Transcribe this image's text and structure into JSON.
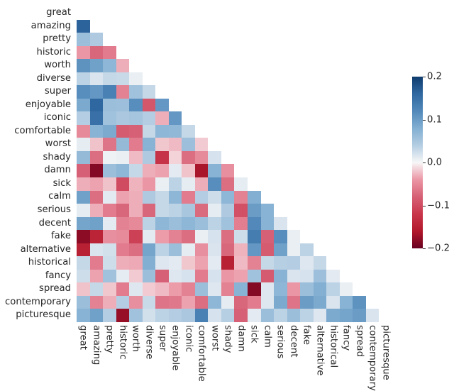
{
  "chart_data": {
    "type": "heatmap",
    "title": "",
    "xlabel": "",
    "ylabel": "",
    "grid": false,
    "triangular": "lower",
    "diagonal_shown": false,
    "colormap": "RdBu (red-white-blue, diverging)",
    "colorbar": {
      "position": "right",
      "vmin": -0.2,
      "vmax": 0.2,
      "ticks": [
        0.2,
        0.1,
        0.0,
        -0.1,
        -0.2
      ],
      "tick_labels": [
        "0.2",
        "0.1",
        "0.0",
        "−0.1",
        "−0.2"
      ],
      "low_color": "#c9364b",
      "mid_color": "#f7f7f7",
      "high_color": "#2f6fa8"
    },
    "categories": [
      "great",
      "amazing",
      "pretty",
      "historic",
      "worth",
      "diverse",
      "super",
      "enjoyable",
      "iconic",
      "comfortable",
      "worst",
      "shady",
      "damn",
      "sick",
      "calm",
      "serious",
      "decent",
      "fake",
      "alternative",
      "historical",
      "fancy",
      "spread",
      "contemporary",
      "picturesque"
    ],
    "xtick_labels": [
      "great",
      "amazing",
      "pretty",
      "historic",
      "worth",
      "diverse",
      "super",
      "enjoyable",
      "iconic",
      "comfortable",
      "worst",
      "shady",
      "damn",
      "sick",
      "calm",
      "serious",
      "decent",
      "fake",
      "alternative",
      "historical",
      "fancy",
      "spread",
      "contemporary",
      "picturesque"
    ],
    "ytick_labels": [
      "great",
      "amazing",
      "pretty",
      "historic",
      "worth",
      "diverse",
      "super",
      "enjoyable",
      "iconic",
      "comfortable",
      "worst",
      "shady",
      "damn",
      "sick",
      "calm",
      "serious",
      "decent",
      "fake",
      "alternative",
      "historical",
      "fancy",
      "spread",
      "contemporary",
      "picturesque"
    ],
    "values": [
      [
        null,
        null,
        null,
        null,
        null,
        null,
        null,
        null,
        null,
        null,
        null,
        null,
        null,
        null,
        null,
        null,
        null,
        null,
        null,
        null,
        null,
        null,
        null,
        null
      ],
      [
        0.165,
        null,
        null,
        null,
        null,
        null,
        null,
        null,
        null,
        null,
        null,
        null,
        null,
        null,
        null,
        null,
        null,
        null,
        null,
        null,
        null,
        null,
        null,
        null
      ],
      [
        0.06,
        0.045,
        null,
        null,
        null,
        null,
        null,
        null,
        null,
        null,
        null,
        null,
        null,
        null,
        null,
        null,
        null,
        null,
        null,
        null,
        null,
        null,
        null,
        null
      ],
      [
        -0.04,
        -0.075,
        -0.06,
        null,
        null,
        null,
        null,
        null,
        null,
        null,
        null,
        null,
        null,
        null,
        null,
        null,
        null,
        null,
        null,
        null,
        null,
        null,
        null,
        null
      ],
      [
        0.11,
        0.095,
        0.07,
        -0.03,
        null,
        null,
        null,
        null,
        null,
        null,
        null,
        null,
        null,
        null,
        null,
        null,
        null,
        null,
        null,
        null,
        null,
        null,
        null,
        null
      ],
      [
        0.035,
        0.018,
        0.03,
        0.028,
        0.008,
        null,
        null,
        null,
        null,
        null,
        null,
        null,
        null,
        null,
        null,
        null,
        null,
        null,
        null,
        null,
        null,
        null,
        null,
        null
      ],
      [
        0.115,
        0.105,
        0.13,
        -0.055,
        0.055,
        0.03,
        null,
        null,
        null,
        null,
        null,
        null,
        null,
        null,
        null,
        null,
        null,
        null,
        null,
        null,
        null,
        null,
        null,
        null
      ],
      [
        0.085,
        0.16,
        0.06,
        0.058,
        0.115,
        -0.09,
        0.105,
        null,
        null,
        null,
        null,
        null,
        null,
        null,
        null,
        null,
        null,
        null,
        null,
        null,
        null,
        null,
        null,
        null
      ],
      [
        0.04,
        0.15,
        0.055,
        0.048,
        0.052,
        0.04,
        -0.03,
        0.105,
        null,
        null,
        null,
        null,
        null,
        null,
        null,
        null,
        null,
        null,
        null,
        null,
        null,
        null,
        null,
        null
      ],
      [
        -0.05,
        0.075,
        0.085,
        -0.085,
        -0.08,
        0.03,
        0.07,
        0.068,
        0.03,
        null,
        null,
        null,
        null,
        null,
        null,
        null,
        null,
        null,
        null,
        null,
        null,
        null,
        null,
        null
      ],
      [
        0.01,
        -0.022,
        -0.065,
        0.065,
        -0.06,
        0.075,
        -0.02,
        -0.025,
        0.058,
        -0.018,
        null,
        null,
        null,
        null,
        null,
        null,
        null,
        null,
        null,
        null,
        null,
        null,
        null,
        null
      ],
      [
        0.065,
        -0.07,
        0.005,
        0.008,
        -0.025,
        0.045,
        -0.125,
        -0.015,
        -0.07,
        -0.05,
        0.02,
        null,
        null,
        null,
        null,
        null,
        null,
        null,
        null,
        null,
        null,
        null,
        null,
        null
      ],
      [
        -0.08,
        -0.185,
        0.06,
        0.07,
        0.03,
        -0.03,
        -0.035,
        0.012,
        -0.022,
        -0.165,
        0.075,
        -0.045,
        null,
        null,
        null,
        null,
        null,
        null,
        null,
        null,
        null,
        null,
        null,
        null
      ],
      [
        -0.03,
        -0.035,
        -0.022,
        -0.1,
        -0.028,
        -0.04,
        0.008,
        0.035,
        0.01,
        -0.03,
        0.115,
        -0.07,
        0.01,
        null,
        null,
        null,
        null,
        null,
        null,
        null,
        null,
        null,
        null,
        null
      ],
      [
        0.095,
        -0.07,
        0.012,
        -0.035,
        -0.03,
        0.045,
        0.03,
        0.07,
        -0.06,
        0.04,
        0.025,
        0.07,
        -0.055,
        0.08,
        null,
        null,
        null,
        null,
        null,
        null,
        null,
        null,
        null,
        null
      ],
      [
        0.01,
        -0.03,
        -0.06,
        -0.075,
        -0.03,
        -0.075,
        0.03,
        0.035,
        0.05,
        -0.072,
        0.01,
        0.045,
        -0.095,
        0.1,
        0.075,
        null,
        null,
        null,
        null,
        null,
        null,
        null,
        null,
        null
      ],
      [
        0.09,
        0.095,
        0.012,
        -0.055,
        -0.05,
        0.035,
        0.07,
        0.06,
        0.07,
        0.06,
        0.035,
        0.055,
        -0.058,
        0.12,
        0.075,
        0.018,
        null,
        null,
        null,
        null,
        null,
        null,
        null,
        null
      ],
      [
        -0.18,
        -0.145,
        -0.045,
        -0.048,
        -0.11,
        0.012,
        -0.038,
        -0.055,
        -0.07,
        0.008,
        0.02,
        -0.07,
        0.025,
        0.135,
        -0.08,
        0.115,
        0.008,
        null,
        null,
        null,
        null,
        null,
        null,
        null
      ],
      [
        -0.15,
        0.018,
        0.022,
        -0.06,
        -0.07,
        0.09,
        0.035,
        0.06,
        0.01,
        -0.045,
        0.018,
        -0.075,
        -0.028,
        0.105,
        -0.085,
        0.095,
        0.008,
        0.035,
        null,
        null,
        null,
        null,
        null,
        null
      ],
      [
        0.03,
        -0.06,
        0.025,
        -0.03,
        -0.032,
        0.08,
        0.015,
        0.012,
        -0.02,
        -0.035,
        0.012,
        -0.15,
        -0.025,
        -0.055,
        0.03,
        0.038,
        0.04,
        0.015,
        0.03,
        null,
        null,
        null,
        null,
        null
      ],
      [
        0.025,
        -0.035,
        0.055,
        0.01,
        -0.018,
        0.06,
        -0.08,
        0.015,
        0.02,
        -0.06,
        0.02,
        -0.04,
        -0.035,
        0.055,
        -0.085,
        0.075,
        0.018,
        0.02,
        0.058,
        0.012,
        null,
        null,
        null,
        null
      ],
      [
        -0.022,
        0.03,
        -0.02,
        -0.06,
        0.015,
        -0.018,
        -0.025,
        -0.038,
        -0.055,
        0.06,
        0.015,
        -0.055,
        0.075,
        -0.185,
        0.015,
        0.07,
        -0.04,
        0.06,
        0.08,
        0.035,
        0.008,
        null,
        null,
        null
      ],
      [
        0.06,
        -0.055,
        -0.03,
        0.04,
        -0.045,
        0.028,
        -0.065,
        -0.062,
        -0.035,
        -0.07,
        0.07,
        0.01,
        -0.075,
        -0.06,
        0.015,
        0.085,
        -0.065,
        0.1,
        0.085,
        0.018,
        0.075,
        0.11,
        null,
        null
      ],
      [
        0.075,
        0.095,
        0.04,
        -0.175,
        0.055,
        0.022,
        0.035,
        0.04,
        0.048,
        0.13,
        0.02,
        0.038,
        -0.08,
        0.012,
        0.06,
        0.035,
        0.06,
        0.035,
        0.015,
        0.085,
        0.09,
        0.1,
        0.018,
        null
      ]
    ]
  }
}
